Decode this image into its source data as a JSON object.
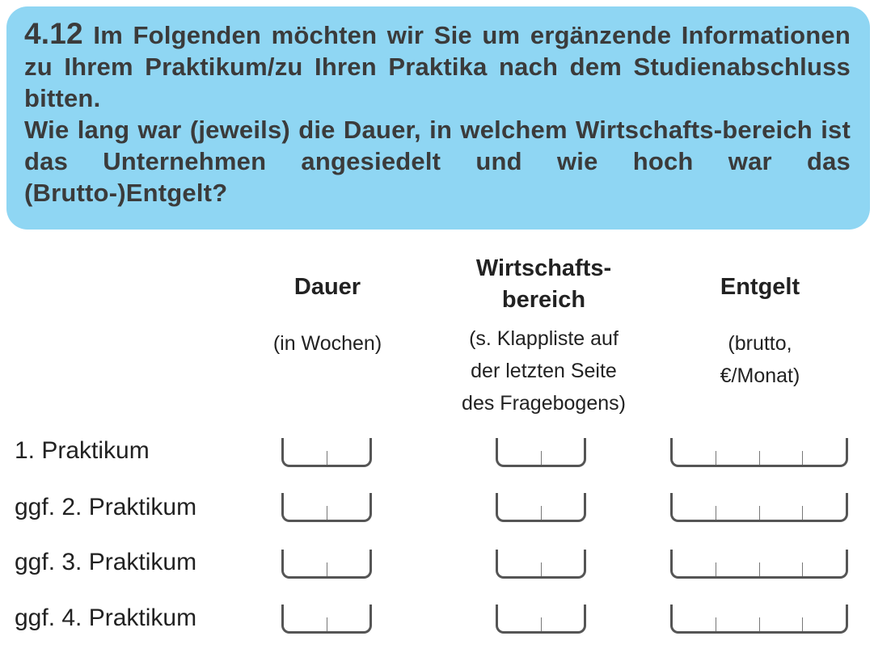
{
  "question": {
    "number": "4.12",
    "text": "Im Folgenden möchten wir Sie um ergänzende Informationen zu Ihrem Praktikum/zu Ihren Praktika nach dem Studienabschluss bitten.",
    "subtext": "Wie lang war (jeweils) die Dauer, in welchem Wirtschafts-bereich ist das Unternehmen angesiedelt und wie hoch war das (Brutto-)Entgelt?"
  },
  "columns": [
    {
      "title_line1": "Dauer",
      "title_line2": "",
      "sub_line1": "(in Wochen)",
      "sub_line2": "",
      "sub_line3": ""
    },
    {
      "title_line1": "Wirtschafts-",
      "title_line2": "bereich",
      "sub_line1": "(s. Klappliste auf",
      "sub_line2": "der letzten Seite",
      "sub_line3": "des Fragebogens)"
    },
    {
      "title_line1": "Entgelt",
      "title_line2": "",
      "sub_line1": "(brutto,",
      "sub_line2": "€/Monat)",
      "sub_line3": ""
    }
  ],
  "rows": [
    {
      "label": "1. Praktikum"
    },
    {
      "label": "ggf. 2. Praktikum"
    },
    {
      "label": "ggf. 3. Praktikum"
    },
    {
      "label": "ggf. 4. Praktikum"
    }
  ]
}
